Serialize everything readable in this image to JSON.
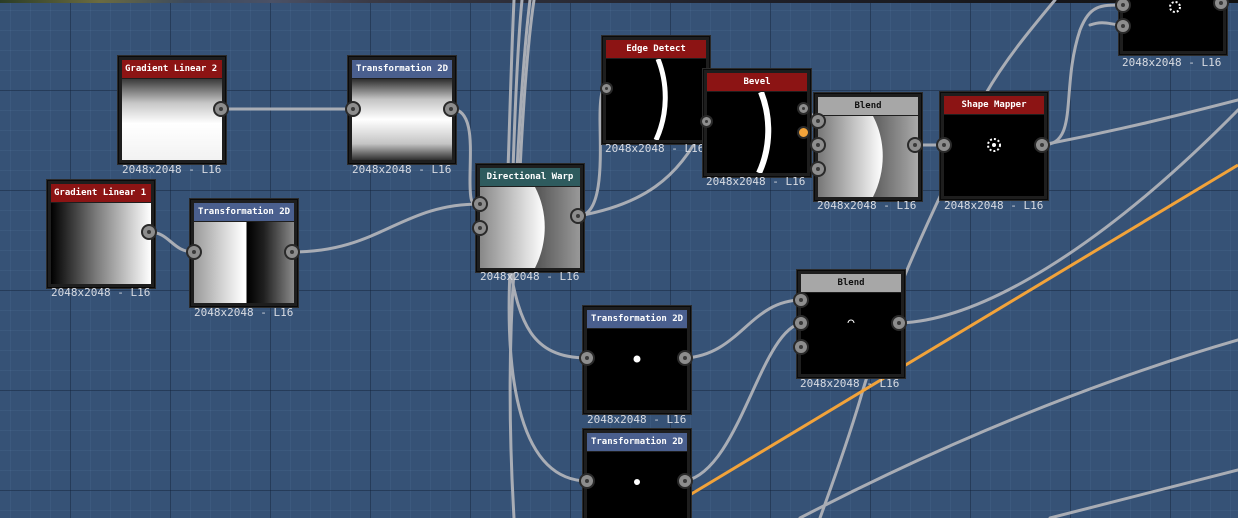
{
  "graph": {
    "grid_color": "#365276",
    "highlight_wire_color": "#f2a33a",
    "wire_color": "#a9adb5"
  },
  "nodes": {
    "gradient_linear_2": {
      "title": "Gradient Linear 2",
      "size_label": "2048x2048 - L16"
    },
    "gradient_linear_1": {
      "title": "Gradient Linear 1",
      "size_label": "2048x2048 - L16"
    },
    "transformation_2d_a": {
      "title": "Transformation 2D",
      "size_label": "2048x2048 - L16"
    },
    "transformation_2d_b": {
      "title": "Transformation 2D",
      "size_label": "2048x2048 - L16"
    },
    "directional_warp": {
      "title": "Directional Warp",
      "size_label": "2048x2048 - L16"
    },
    "edge_detect": {
      "title": "Edge Detect",
      "size_label": "2048x2048 - L16"
    },
    "bevel": {
      "title": "Bevel",
      "size_label": "2048x2048 - L16"
    },
    "blend_top": {
      "title": "Blend",
      "size_label": "2048x2048 - L16"
    },
    "shape_mapper": {
      "title": "Shape Mapper",
      "size_label": "2048x2048 - L16"
    },
    "top_right_node": {
      "size_label": "2048x2048 - L16"
    },
    "transformation_2d_c": {
      "title": "Transformation 2D",
      "size_label": "2048x2048 - L16"
    },
    "transformation_2d_d": {
      "title": "Transformation 2D"
    },
    "blend_bottom": {
      "title": "Blend",
      "size_label": "2048x2048 - L16"
    }
  }
}
